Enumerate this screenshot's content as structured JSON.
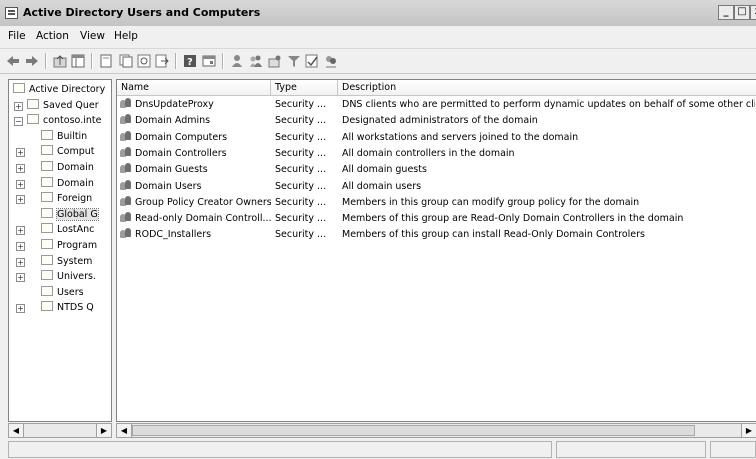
{
  "window": {
    "title": "Active Directory Users and Computers",
    "controls": [
      "_",
      "□",
      "x"
    ]
  },
  "menu": [
    "File",
    "Action",
    "View",
    "Help"
  ],
  "toolbar": {
    "icons": [
      "back-arrow-icon",
      "forward-arrow-icon",
      "up-folder-icon",
      "show-tree-icon",
      "properties-icon",
      "copy-icon",
      "refresh-icon",
      "export-icon",
      "help-icon",
      "console-icon",
      "add-user-icon",
      "add-group-icon",
      "add-ou-icon",
      "filter-icon",
      "delegate-icon",
      "find-icon"
    ]
  },
  "tree": [
    {
      "label": "Active Directory",
      "expander": "",
      "indent": 0
    },
    {
      "label": "Saved Quer",
      "expander": "+",
      "indent": 1
    },
    {
      "label": "contoso.inte",
      "expander": "−",
      "indent": 1
    },
    {
      "label": "Builtin",
      "expander": "",
      "indent": 2
    },
    {
      "label": "Comput",
      "expander": "+",
      "indent": 2
    },
    {
      "label": "Domain",
      "expander": "+",
      "indent": 2
    },
    {
      "label": "Domain",
      "expander": "+",
      "indent": 2
    },
    {
      "label": "Foreign",
      "expander": "+",
      "indent": 2
    },
    {
      "label": "Global G",
      "expander": "",
      "indent": 2,
      "selected": true
    },
    {
      "label": "LostAnc",
      "expander": "+",
      "indent": 2
    },
    {
      "label": "Program",
      "expander": "+",
      "indent": 2
    },
    {
      "label": "System",
      "expander": "+",
      "indent": 2
    },
    {
      "label": "Univers.",
      "expander": "+",
      "indent": 2
    },
    {
      "label": "Users",
      "expander": "",
      "indent": 2
    },
    {
      "label": "NTDS Q",
      "expander": "+",
      "indent": 2
    }
  ],
  "list": {
    "columns": [
      "Name",
      "Type",
      "Description"
    ],
    "rows": [
      {
        "name": "DnsUpdateProxy",
        "type": "Security ...",
        "description": "DNS clients who are permitted to perform dynamic updates on behalf of some other clients"
      },
      {
        "name": "Domain Admins",
        "type": "Security ...",
        "description": "Designated administrators of the domain"
      },
      {
        "name": "Domain Computers",
        "type": "Security ...",
        "description": "All workstations and servers joined to the domain"
      },
      {
        "name": "Domain Controllers",
        "type": "Security ...",
        "description": "All domain controllers in the domain"
      },
      {
        "name": "Domain Guests",
        "type": "Security ...",
        "description": "All domain guests"
      },
      {
        "name": "Domain Users",
        "type": "Security ...",
        "description": "All domain users"
      },
      {
        "name": "Group Policy Creator Owners",
        "type": "Security ...",
        "description": "Members in this group can modify group policy for the domain"
      },
      {
        "name": "Read-only Domain Controll...",
        "type": "Security ...",
        "description": "Members of this group are Read-Only Domain Controllers in the domain"
      },
      {
        "name": "RODC_Installers",
        "type": "Security ...",
        "description": "Members of this group can install Read-Only Domain Controlers"
      }
    ]
  }
}
